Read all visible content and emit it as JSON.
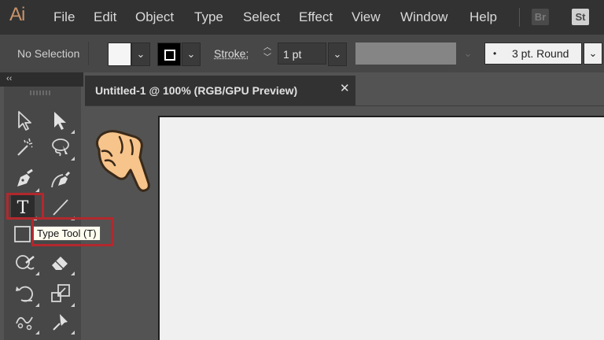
{
  "app": {
    "logo": "Ai"
  },
  "menubar": {
    "items": [
      "File",
      "Edit",
      "Object",
      "Type",
      "Select",
      "Effect",
      "View",
      "Window",
      "Help"
    ],
    "badges": {
      "bridge": "Br",
      "stock": "St"
    }
  },
  "controlbar": {
    "selection_status": "No Selection",
    "fill_color": "#f5f5f5",
    "stroke_color": "#000000",
    "stroke_label": "Stroke:",
    "stroke_value": "1 pt",
    "brush_label": "3 pt. Round",
    "brush_dot": "•"
  },
  "toolpanel": {
    "collapse_glyph": "‹‹",
    "tools": [
      "selection-tool",
      "direct-selection-tool",
      "magic-wand-tool",
      "lasso-tool",
      "pen-tool",
      "curvature-tool",
      "type-tool",
      "line-segment-tool",
      "rectangle-tool",
      "shaper-tool",
      "eraser-tool",
      "rotate-tool",
      "scale-tool",
      "puppet-warp-tool",
      "pin-tool"
    ],
    "type_tool_glyph": "T"
  },
  "tooltip": {
    "text": "Type Tool (T)"
  },
  "document": {
    "tab_title": "Untitled-1 @ 100% (RGB/GPU Preview)",
    "close_glyph": "✕"
  },
  "colors": {
    "highlight": "#b3282d",
    "ai_brand": "#c7936b",
    "hand_fill": "#f7c48b"
  }
}
